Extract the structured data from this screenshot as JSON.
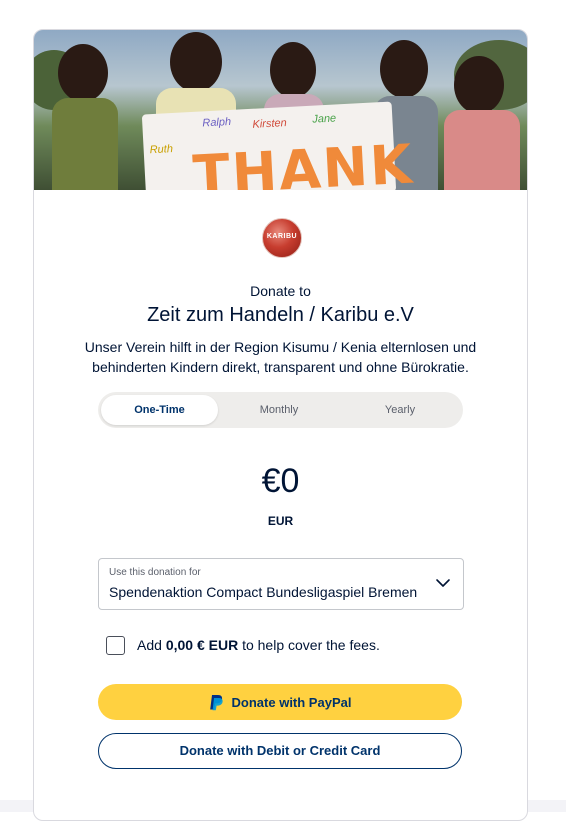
{
  "header": {
    "logo_text": "KARIBU",
    "donate_to_label": "Donate to",
    "org_name": "Zeit zum Handeln / Karibu e.V",
    "org_description": "Unser Verein hilft in der Region Kisumu / Kenia elternlosen und behinderten Kindern direkt, transparent und ohne Bürokratie."
  },
  "hero": {
    "banner_text": "THANK"
  },
  "frequency": {
    "tabs": [
      {
        "label": "One-Time",
        "active": true
      },
      {
        "label": "Monthly",
        "active": false
      },
      {
        "label": "Yearly",
        "active": false
      }
    ]
  },
  "amount": {
    "value": "€0",
    "currency": "EUR"
  },
  "designation": {
    "label": "Use this donation for",
    "value": "Spendenaktion Compact Bundesligaspiel Bremen",
    "icon": "chevron-down-icon"
  },
  "fees": {
    "checked": false,
    "prefix": "Add",
    "amount": "0,00 € EUR",
    "suffix": "to help cover the fees."
  },
  "buttons": {
    "paypal_label": "Donate with PayPal",
    "paypal_icon": "paypal-icon",
    "card_label": "Donate with Debit or Credit Card"
  },
  "colors": {
    "primary": "#00336b",
    "text": "#001435",
    "paypal_yellow": "#ffd140",
    "tab_track": "#eeedeb"
  }
}
